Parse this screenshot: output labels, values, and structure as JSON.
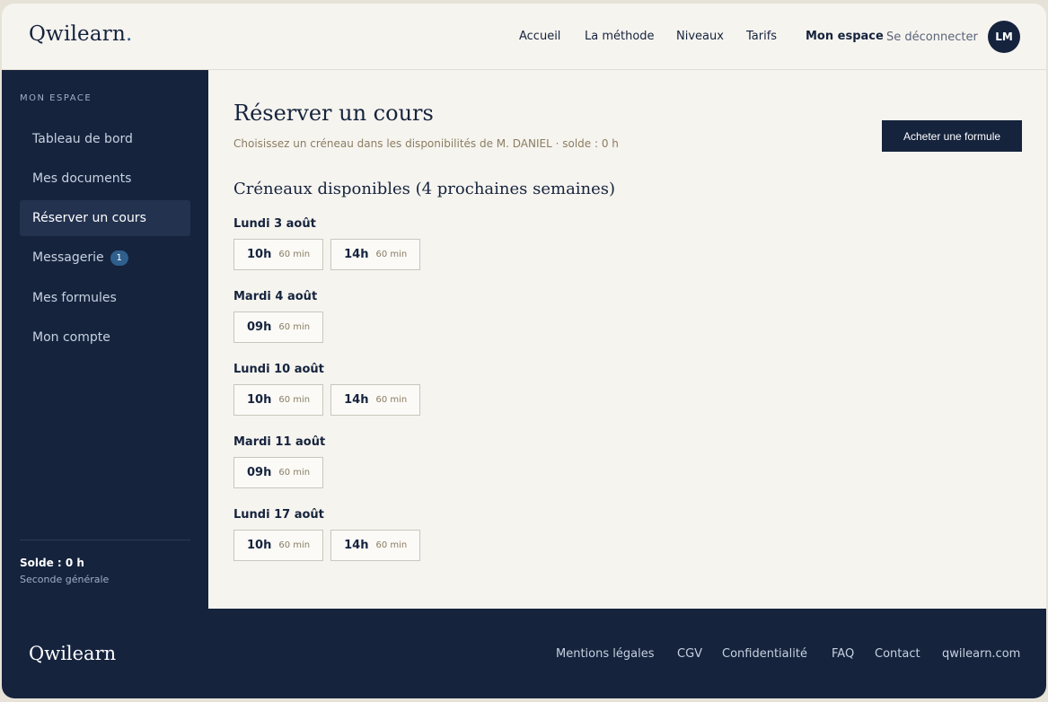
{
  "header": {
    "logo": "Qwilearn",
    "logo_dot": ".",
    "nav": [
      "Accueil",
      "La méthode",
      "Niveaux",
      "Tarifs",
      "Mon espace"
    ],
    "logout": "Se déconnecter",
    "avatar_initials": "LM"
  },
  "sidebar": {
    "heading": "MON ESPACE",
    "items": [
      {
        "label": "Tableau de bord"
      },
      {
        "label": "Mes documents"
      },
      {
        "label": "Réserver un cours",
        "active": true
      },
      {
        "label": "Messagerie",
        "badge": "1"
      },
      {
        "label": "Mes formules"
      },
      {
        "label": "Mon compte"
      }
    ],
    "balance": "Solde : 0 h",
    "level": "Seconde générale"
  },
  "main": {
    "title": "Réserver un cours",
    "subtitle": "Choisissez un créneau dans les disponibilités de M. DANIEL · solde : 0 h",
    "buy_button": "Acheter une formule",
    "section_title": "Créneaux disponibles (4 prochaines semaines)",
    "days": [
      {
        "label": "Lundi 3 août",
        "slots": [
          {
            "time": "10h",
            "duration": "60 min"
          },
          {
            "time": "14h",
            "duration": "60 min"
          }
        ]
      },
      {
        "label": "Mardi 4 août",
        "slots": [
          {
            "time": "09h",
            "duration": "60 min"
          }
        ]
      },
      {
        "label": "Lundi 10 août",
        "slots": [
          {
            "time": "10h",
            "duration": "60 min"
          },
          {
            "time": "14h",
            "duration": "60 min"
          }
        ]
      },
      {
        "label": "Mardi 11 août",
        "slots": [
          {
            "time": "09h",
            "duration": "60 min"
          }
        ]
      },
      {
        "label": "Lundi 17 août",
        "slots": [
          {
            "time": "10h",
            "duration": "60 min"
          },
          {
            "time": "14h",
            "duration": "60 min"
          }
        ]
      }
    ]
  },
  "footer": {
    "logo": "Qwilearn",
    "links": [
      "Mentions légales",
      "CGV",
      "Confidentialité",
      "FAQ",
      "Contact",
      "qwilearn.com"
    ]
  },
  "colors": {
    "navy": "#15233d",
    "background": "#f6f4ef",
    "accent": "#2f5f8c",
    "muted_gold": "#8a7d62"
  }
}
